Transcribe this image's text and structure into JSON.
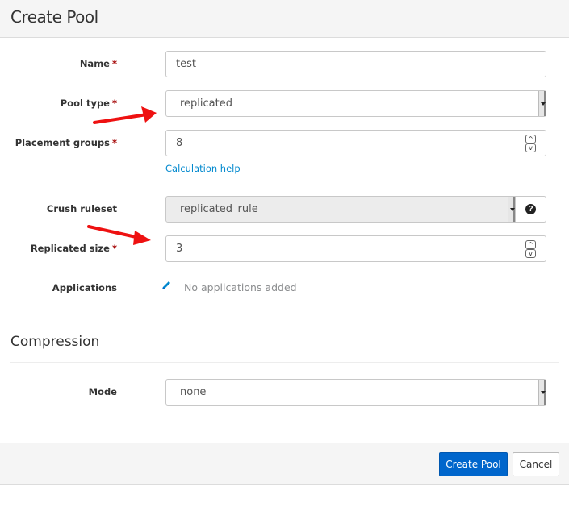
{
  "header": {
    "title": "Create Pool"
  },
  "form": {
    "required_marker": "*",
    "name": {
      "label": "Name",
      "value": "test"
    },
    "pool_type": {
      "label": "Pool type",
      "value": "replicated"
    },
    "placement_groups": {
      "label": "Placement groups",
      "value": "8",
      "help_link": "Calculation help"
    },
    "crush_ruleset": {
      "label": "Crush ruleset",
      "value": "replicated_rule",
      "help_icon": "?"
    },
    "replicated_size": {
      "label": "Replicated size",
      "value": "3"
    },
    "applications": {
      "label": "Applications",
      "empty_text": "No applications added"
    },
    "spinner": {
      "up": "^",
      "down": "v"
    }
  },
  "compression": {
    "title": "Compression",
    "mode": {
      "label": "Mode",
      "value": "none"
    }
  },
  "footer": {
    "submit_label": "Create Pool",
    "cancel_label": "Cancel"
  },
  "colors": {
    "primary": "#0066cc",
    "link": "#0088ce",
    "required": "#a30000",
    "annotation_arrow": "#ee1111"
  }
}
